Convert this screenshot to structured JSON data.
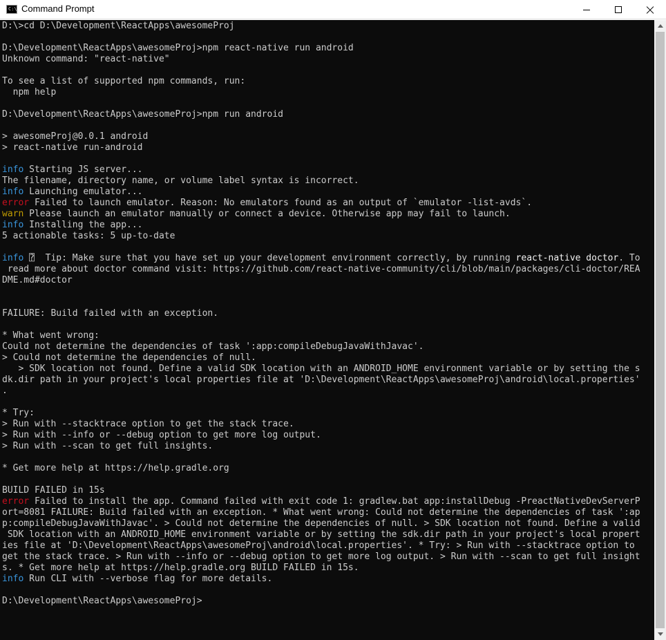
{
  "window": {
    "title": "Command Prompt",
    "app_icon": "cmd-icon",
    "app_icon_glyph": "C:\\",
    "controls": [
      "minimize-icon",
      "maximize-icon",
      "close-icon"
    ]
  },
  "colors": {
    "background": "#0c0c0c",
    "text": "#cccccc",
    "info": "#3a96dd",
    "error": "#c50f1f",
    "warn": "#c19c00"
  },
  "console": {
    "lines": [
      {
        "text": "D:\\>cd D:\\Development\\ReactApps\\awesomeProj"
      },
      {
        "text": ""
      },
      {
        "text": "D:\\Development\\ReactApps\\awesomeProj>npm react-native run android"
      },
      {
        "text": "Unknown command: \"react-native\""
      },
      {
        "text": ""
      },
      {
        "text": "To see a list of supported npm commands, run:"
      },
      {
        "text": "  npm help"
      },
      {
        "text": ""
      },
      {
        "text": "D:\\Development\\ReactApps\\awesomeProj>npm run android"
      },
      {
        "text": ""
      },
      {
        "text": "> awesomeProj@0.0.1 android"
      },
      {
        "text": "> react-native run-android"
      },
      {
        "text": ""
      },
      {
        "tag": "info",
        "text": " Starting JS server..."
      },
      {
        "text": "The filename, directory name, or volume label syntax is incorrect."
      },
      {
        "tag": "info",
        "text": " Launching emulator..."
      },
      {
        "tag": "error",
        "text": " Failed to launch emulator. Reason: No emulators found as an output of `emulator -list-avds`."
      },
      {
        "tag": "warn",
        "text": " Please launch an emulator manually or connect a device. Otherwise app may fail to launch."
      },
      {
        "tag": "info",
        "text": " Installing the app..."
      },
      {
        "text": "5 actionable tasks: 5 up-to-date"
      },
      {
        "text": ""
      },
      {
        "tag": "info",
        "text": " ⍰  Tip: Make sure that you have set up your development environment correctly, by running ",
        "emph": "react-native doctor",
        "after": ". To"
      },
      {
        "text": " read more about doctor command visit: https://github.com/react-native-community/cli/blob/main/packages/cli-doctor/REA"
      },
      {
        "text": "DME.md#doctor"
      },
      {
        "text": ""
      },
      {
        "text": ""
      },
      {
        "text": "FAILURE: Build failed with an exception."
      },
      {
        "text": ""
      },
      {
        "text": "* What went wrong:"
      },
      {
        "text": "Could not determine the dependencies of task ':app:compileDebugJavaWithJavac'."
      },
      {
        "text": "> Could not determine the dependencies of null."
      },
      {
        "text": "   > SDK location not found. Define a valid SDK location with an ANDROID_HOME environment variable or by setting the s"
      },
      {
        "text": "dk.dir path in your project's local properties file at 'D:\\Development\\ReactApps\\awesomeProj\\android\\local.properties'"
      },
      {
        "text": "."
      },
      {
        "text": ""
      },
      {
        "text": "* Try:"
      },
      {
        "text": "> Run with --stacktrace option to get the stack trace."
      },
      {
        "text": "> Run with --info or --debug option to get more log output."
      },
      {
        "text": "> Run with --scan to get full insights."
      },
      {
        "text": ""
      },
      {
        "text": "* Get more help at https://help.gradle.org"
      },
      {
        "text": ""
      },
      {
        "text": "BUILD FAILED in 15s"
      },
      {
        "tag": "error",
        "text": " Failed to install the app. Command failed with exit code 1: gradlew.bat app:installDebug -PreactNativeDevServerP"
      },
      {
        "text": "ort=8081 FAILURE: Build failed with an exception. * What went wrong: Could not determine the dependencies of task ':ap"
      },
      {
        "text": "p:compileDebugJavaWithJavac'. > Could not determine the dependencies of null. > SDK location not found. Define a valid"
      },
      {
        "text": " SDK location with an ANDROID_HOME environment variable or by setting the sdk.dir path in your project's local propert"
      },
      {
        "text": "ies file at 'D:\\Development\\ReactApps\\awesomeProj\\android\\local.properties'. * Try: > Run with --stacktrace option to"
      },
      {
        "text": "get the stack trace. > Run with --info or --debug option to get more log output. > Run with --scan to get full insight"
      },
      {
        "text": "s. * Get more help at https://help.gradle.org BUILD FAILED in 15s."
      },
      {
        "tag": "info",
        "text": " Run CLI with --verbose flag for more details."
      },
      {
        "text": ""
      },
      {
        "text": "D:\\Development\\ReactApps\\awesomeProj>"
      }
    ]
  },
  "scrollbar": {
    "up_icon": "scroll-up-arrow-icon",
    "down_icon": "scroll-down-arrow-icon"
  }
}
